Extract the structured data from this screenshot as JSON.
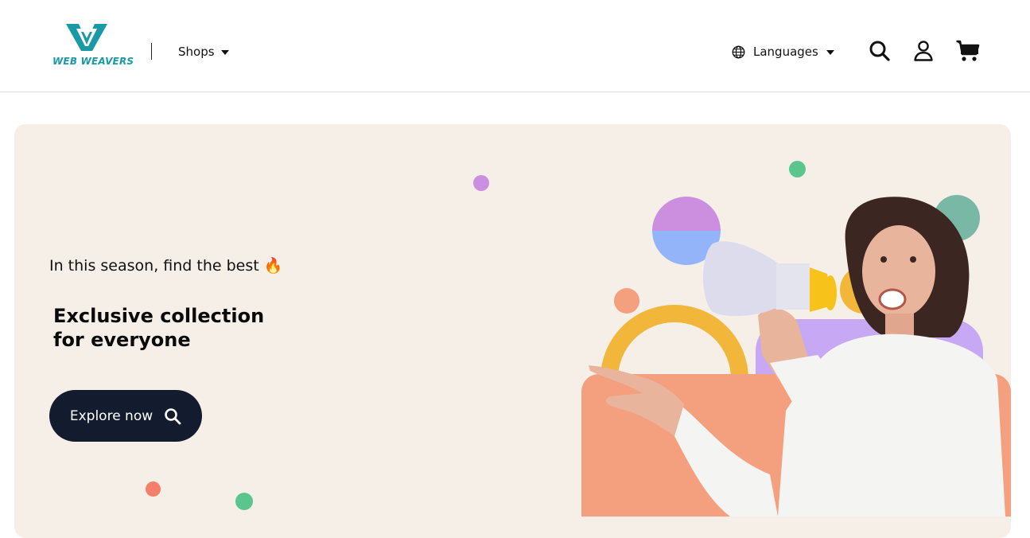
{
  "brand": {
    "name": "WEB WEAVERS",
    "color": "#1a9aa6"
  },
  "nav": {
    "shops_label": "Shops",
    "languages_label": "Languages"
  },
  "icons": {
    "globe": "globe-icon",
    "search": "search-icon",
    "account": "user-icon",
    "cart": "cart-icon"
  },
  "hero": {
    "tagline": "In this season, find the best 🔥",
    "headline_line1": "Exclusive collection",
    "headline_line2": "for everyone",
    "cta_label": "Explore now",
    "background": "#f5efe8"
  },
  "colors": {
    "cta_bg": "#131b2e",
    "peach": "#f4a07f",
    "purple": "#cc8fe0",
    "blue": "#93b4f8",
    "green": "#5bc58e",
    "yellow": "#f2b73a",
    "teal": "#79b8a4"
  }
}
